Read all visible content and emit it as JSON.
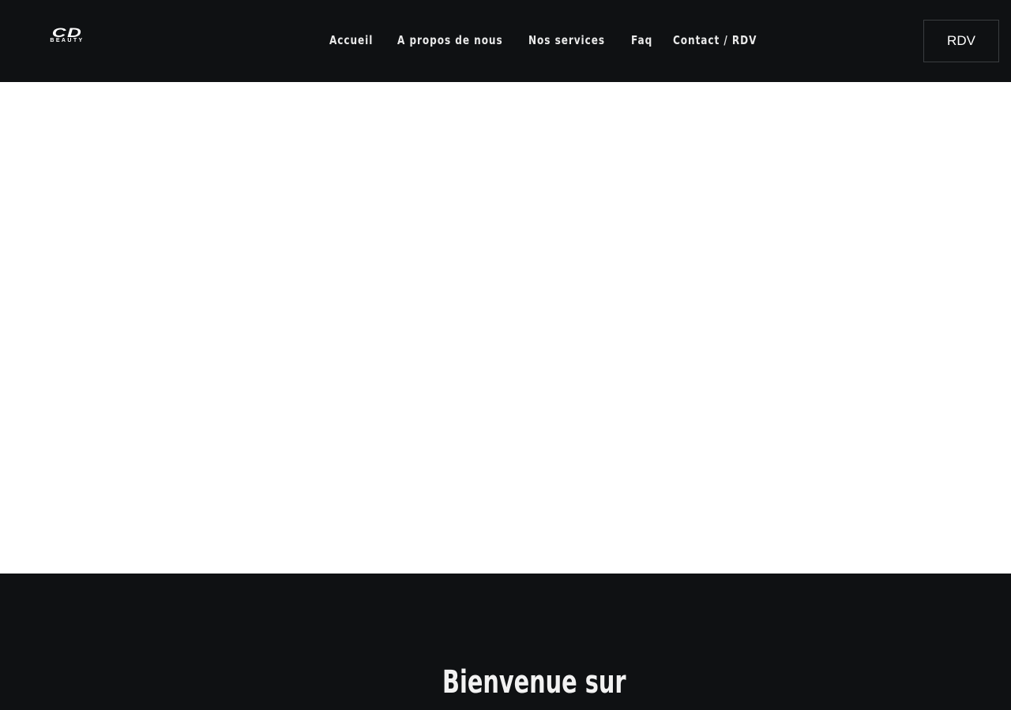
{
  "header": {
    "logo": {
      "top_text": "CD",
      "bottom_text": "BEAUTY"
    },
    "nav": [
      {
        "label": "Accueil"
      },
      {
        "label": "A propos de nous"
      },
      {
        "label": "Nos services"
      },
      {
        "label": "Faq"
      },
      {
        "label": "Contact / RDV"
      }
    ],
    "cta_label": "RDV"
  },
  "welcome": {
    "title": "Bienvenue sur"
  },
  "colors": {
    "header_bg": "#0f1113",
    "text_light": "#e9e9e9",
    "page_bg": "#ffffff"
  }
}
